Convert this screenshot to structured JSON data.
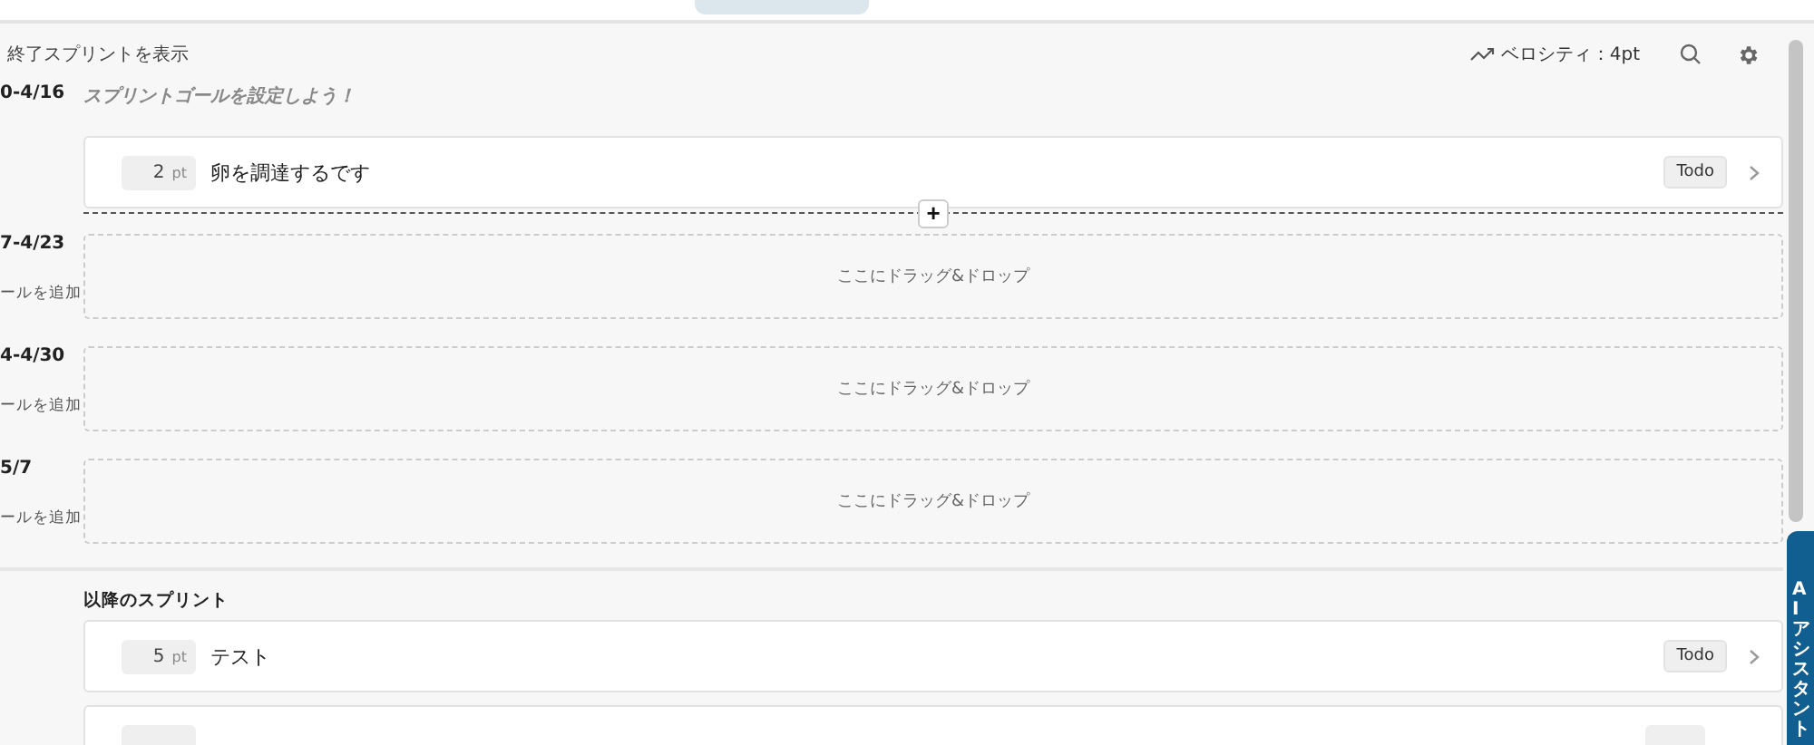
{
  "toolbar": {
    "show_finished": "終了スプリントを表示",
    "velocity": "ベロシティ：4pt"
  },
  "sprints": [
    {
      "dates": "0-4/16",
      "kind": "placeholder",
      "goal": "スプリントゴールを設定しよう！",
      "items": [
        {
          "kind": "task",
          "points": "2",
          "unit": "pt",
          "title": "卵を調達するです",
          "status": "Todo"
        }
      ],
      "insert": "+"
    },
    {
      "dates": "7-4/23",
      "kind": "add_link",
      "goal": "ールを追加",
      "dropzone": "ここにドラッグ&ドロップ"
    },
    {
      "dates": "4-4/30",
      "kind": "add_link",
      "goal": "ールを追加",
      "dropzone": "ここにドラッグ&ドロップ"
    },
    {
      "dates": "5/7",
      "kind": "add_link",
      "goal": "ールを追加",
      "dropzone": "ここにドラッグ&ドロップ"
    }
  ],
  "upcoming": {
    "title": "以降のスプリント",
    "items": [
      {
        "kind": "task",
        "points": "5",
        "unit": "pt",
        "title": "テスト",
        "status": "Todo"
      },
      {
        "kind": "cut"
      }
    ]
  },
  "assistant_tab": "AIアシスタント"
}
